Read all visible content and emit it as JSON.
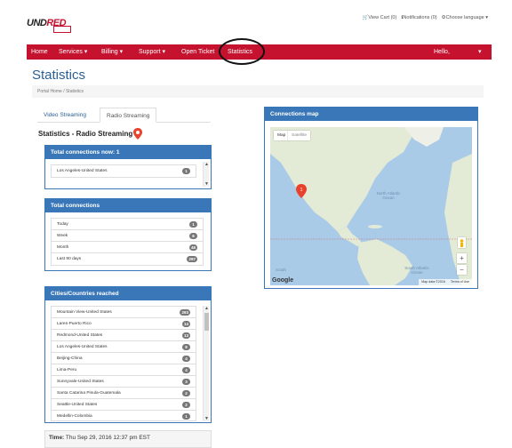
{
  "header": {
    "logo": "UNDRED",
    "links": [
      "View Cart (0)",
      "Notifications (0)",
      "Choose language"
    ]
  },
  "nav": {
    "items": [
      "Home",
      "Services",
      "Billing",
      "Support",
      "Open Ticket",
      "Statistics"
    ],
    "user": "Hello,"
  },
  "page": {
    "title": "Statistics",
    "breadcrumb": [
      "Portal Home",
      "Statistics"
    ]
  },
  "tabs": [
    "Video Streaming",
    "Radio Streaming"
  ],
  "section_title": "Statistics - Radio Streaming",
  "connections_now": {
    "title": "Total connections now: 1",
    "rows": [
      {
        "label": "Los Angeles-United States",
        "count": "1"
      }
    ]
  },
  "total_connections": {
    "title": "Total connections",
    "rows": [
      {
        "label": "Today",
        "count": "1"
      },
      {
        "label": "Week",
        "count": "6"
      },
      {
        "label": "Month",
        "count": "46"
      },
      {
        "label": "Last 90 days",
        "count": "297"
      }
    ]
  },
  "cities": {
    "title": "Cities/Countries reached",
    "rows": [
      {
        "label": "Mountain View-United States",
        "count": "263"
      },
      {
        "label": "Lares-Puerto Rico",
        "count": "14"
      },
      {
        "label": "Redmond-United States",
        "count": "13"
      },
      {
        "label": "Los Angeles-United States",
        "count": "8"
      },
      {
        "label": "Beijing-China",
        "count": "4"
      },
      {
        "label": "Lima-Peru",
        "count": "4"
      },
      {
        "label": "Sunnyvale-United States",
        "count": "3"
      },
      {
        "label": "Santa Catarina Pinula-Guatemala",
        "count": "2"
      },
      {
        "label": "Seattle-United States",
        "count": "2"
      },
      {
        "label": "Medellin-Colombia",
        "count": "1"
      }
    ]
  },
  "time": {
    "label": "Time:",
    "value": "Thu Sep 29, 2016 12:37 pm EST"
  },
  "map": {
    "title": "Connections map",
    "type_buttons": [
      "Map",
      "Satellite"
    ],
    "labels": [
      "North Atlantic Ocean",
      "South Atlantic Ocean",
      "South"
    ],
    "footer": [
      "Map data ©2016",
      "Terms of Use"
    ],
    "google": "Google",
    "marker_count": "1"
  },
  "colors": {
    "brand_red": "#c4122f",
    "panel_blue": "#3a77b8",
    "title_blue": "#2a5f96"
  }
}
